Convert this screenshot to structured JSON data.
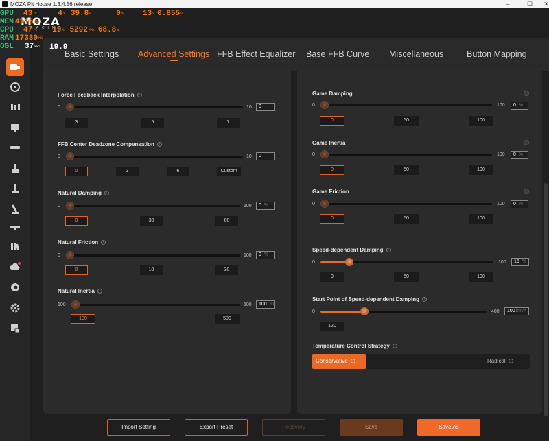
{
  "window": {
    "title": "MOZA Pit House 1.3.4.56 release",
    "controls": [
      "–",
      "☐",
      "✕"
    ]
  },
  "osd": {
    "rows": [
      {
        "label": "GPU",
        "values": [
          {
            "v": "43",
            "u": "°C"
          },
          {
            "v": "4",
            "u": "%"
          },
          {
            "v": "39.8",
            "u": "W"
          },
          {
            "v": "0",
            "u": "%"
          },
          {
            "v": "13",
            "u": "%"
          },
          {
            "v": "0.855",
            "u": "V"
          }
        ]
      },
      {
        "label": "MEM",
        "values": [
          {
            "v": "4116",
            "u": "MB"
          }
        ]
      },
      {
        "label": "CPU",
        "values": [
          {
            "v": "47",
            "u": "°C"
          },
          {
            "v": "19",
            "u": "%"
          },
          {
            "v": "5292",
            "u": "MHz"
          },
          {
            "v": "68.8",
            "u": "W"
          }
        ]
      },
      {
        "label": "RAM",
        "values": [
          {
            "v": "17330",
            "u": "MB"
          }
        ]
      },
      {
        "label": "OGL",
        "values": [
          {
            "v": "37",
            "u": "FPS"
          }
        ]
      }
    ],
    "fps_overlay": "19.9"
  },
  "logo": {
    "text": "MOZA",
    "sub": "RACING"
  },
  "tabs": [
    {
      "label": "Basic Settings",
      "active": false
    },
    {
      "label": "Advanced Settings",
      "active": true
    },
    {
      "label": "FFB Effect Equalizer",
      "active": false
    },
    {
      "label": "Base FFB Curve",
      "active": false
    },
    {
      "label": "Miscellaneous",
      "active": false
    },
    {
      "label": "Button Mapping",
      "active": false
    }
  ],
  "sidebar": [
    "wheelbase-icon",
    "steering-wheel-icon",
    "pedals-icon",
    "dashboard-icon",
    "hub-icon",
    "handbrake-icon",
    "shifter-icon",
    "sequential-shifter-icon",
    "stalk-icon",
    "library-icon",
    "cloud-update-icon",
    "pit-icon",
    "settings-icon",
    "help-icon"
  ],
  "left_panel": {
    "ffb_interpolation": {
      "title": "Force Feedback Interpolation",
      "min": "0",
      "max": "10",
      "value": "0",
      "level": 0,
      "presets": [
        "3",
        "5",
        "7"
      ]
    },
    "center_deadzone": {
      "title": "FFB Center Deadzone Compensation",
      "min": "0",
      "max": "10",
      "value": "0",
      "level": 0,
      "presets": [
        "0",
        "3",
        "6",
        "Custom"
      ]
    },
    "natural_damping": {
      "title": "Natural Damping",
      "min": "0",
      "max": "100",
      "value": "0",
      "unit": "%",
      "level": 0,
      "presets": [
        "0",
        "30",
        "60"
      ]
    },
    "natural_friction": {
      "title": "Natural Friction",
      "min": "0",
      "max": "100",
      "value": "0",
      "unit": "%",
      "level": 0,
      "presets": [
        "0",
        "10",
        "30"
      ]
    },
    "natural_inertia": {
      "title": "Natural Inertia",
      "min": "100",
      "max": "500",
      "value": "100",
      "unit": "%",
      "level": 0,
      "presets": [
        "100",
        "500"
      ]
    }
  },
  "right_panel": {
    "game_damping": {
      "title": "Game Damping",
      "min": "0",
      "max": "100",
      "value": "0",
      "unit": "%",
      "level": 0,
      "presets": [
        "0",
        "50",
        "100"
      ]
    },
    "game_inertia": {
      "title": "Game Inertia",
      "min": "0",
      "max": "100",
      "value": "0",
      "unit": "%",
      "level": 0,
      "presets": [
        "0",
        "50",
        "100"
      ]
    },
    "game_friction": {
      "title": "Game Friction",
      "min": "0",
      "max": "100",
      "value": "0",
      "unit": "%",
      "level": 0,
      "presets": [
        "0",
        "50",
        "100"
      ]
    },
    "speed_damping": {
      "title": "Speed-dependent Damping",
      "min": "0",
      "max": "100",
      "value": "15",
      "unit": "%",
      "level": 0.15,
      "presets": [
        "0",
        "50",
        "100"
      ]
    },
    "speed_start": {
      "title": "Start Point of Speed-dependent Damping",
      "min": "0",
      "max": "400",
      "value": "100",
      "unit": "km/h",
      "level": 0.25,
      "presets": [
        "120"
      ]
    },
    "temperature": {
      "title": "Temperature Control Strategy",
      "options": [
        "Conservative",
        "Radical"
      ],
      "selected": "Conservative"
    }
  },
  "buttons": {
    "import": "Import Setting",
    "export": "Export Preset",
    "recovery": "Recovery",
    "save": "Save",
    "save_as": "Save As"
  },
  "colors": {
    "accent": "#f06a22",
    "osd_label": "#2ec27e",
    "osd_value": "#ff7a00"
  }
}
